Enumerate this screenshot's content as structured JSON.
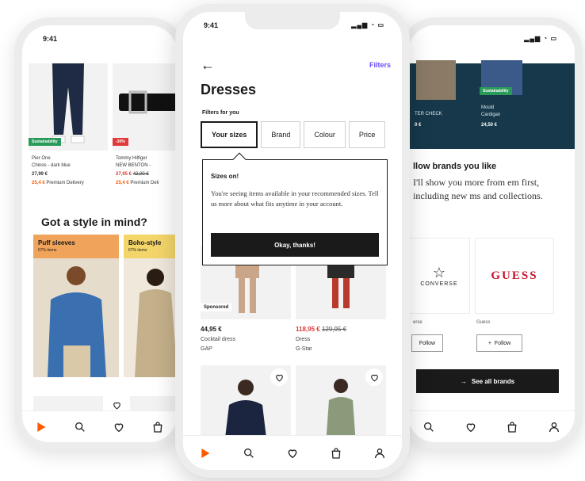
{
  "colors": {
    "accent": "#ff5a00",
    "link": "#6b4cff",
    "sale_red": "#e03a3a",
    "sustainability_green": "#2a9a5a",
    "dark_band": "#16384a"
  },
  "left_phone": {
    "status_time": "9:41",
    "products": [
      {
        "badge": "Sustainability",
        "brand": "Pier One",
        "name": "Chinos - dark blue",
        "price": "27,99 €",
        "promo": "25,4 €",
        "promo_label": "Premium Delivery"
      },
      {
        "badge": "-30%",
        "brand": "Tommy Hilfiger",
        "name": "NEW BENTON -",
        "price": "27,95 €",
        "old_price": "42,00 €",
        "promo": "25,4 €",
        "promo_label": "Premium Deli"
      }
    ],
    "heading": "Got a style in mind?",
    "styles": [
      {
        "title": "Puff sleeves",
        "subtitle": "67% items"
      },
      {
        "title": "Boho-style",
        "subtitle": "67% items"
      }
    ]
  },
  "center_phone": {
    "status_time": "9:41",
    "filters_link": "Filters",
    "title": "Dresses",
    "filters_for_you": "Filters for you",
    "chips": [
      "Your sizes",
      "Brand",
      "Colour",
      "Price"
    ],
    "popover": {
      "title": "Sizes on!",
      "body": "You're seeing items available in your recommended sizes. Tell us more about what fits anytime in your account.",
      "button": "Okay, thanks!"
    },
    "products": [
      {
        "sponsored": "Sponsored",
        "price": "44,95 €",
        "name": "Cocktail dress",
        "brand": "GAP"
      },
      {
        "price": "118,95 €",
        "old_price": "129,95 €",
        "name": "Dress",
        "brand": "G-Star"
      }
    ]
  },
  "right_phone": {
    "products": [
      {
        "badge": "",
        "name": "TER CHECK",
        "price": "0 €"
      },
      {
        "badge": "Sustainability",
        "brand": "Mould",
        "name": "Cardigan",
        "price": "24,50 €"
      }
    ],
    "heading": "llow brands you like",
    "body": "I'll show you more from em first, including new ms and collections.",
    "brands": [
      {
        "logo": "CONVERSE",
        "name": "erse",
        "follow": "Follow"
      },
      {
        "logo": "GUESS",
        "name": "Guess",
        "follow": "Follow"
      }
    ],
    "see_all": "See all brands"
  },
  "tabbar_icons": [
    "home-icon",
    "search-icon",
    "heart-icon",
    "bag-icon",
    "profile-icon"
  ]
}
